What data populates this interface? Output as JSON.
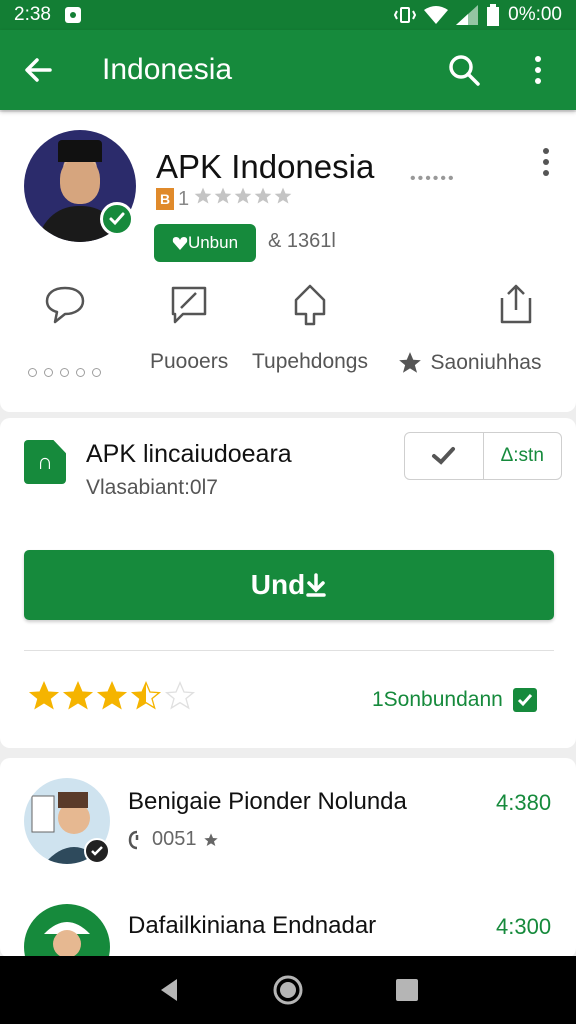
{
  "status_bar": {
    "time": "2:38",
    "battery": "0%:00"
  },
  "app_bar": {
    "title": "Indonesia"
  },
  "app_info": {
    "name": "APK Indonesia",
    "rating_badge": "B",
    "rating_text": "1",
    "rating_stars": 5,
    "install_chip": "Unbun",
    "downloads": "& 1361l",
    "actions": [
      {
        "label": ""
      },
      {
        "label": "Puooers"
      },
      {
        "label": "Tupehdongs"
      },
      {
        "label": "Saoniuhhas"
      }
    ]
  },
  "package": {
    "title": "APK lincaiudoeara",
    "version": "Vlasabiant:0l7",
    "seg_action": "Δ:stn",
    "primary_button": "Und",
    "rating_value": 3.5,
    "rating_link": "1Sonbundann"
  },
  "reviews": [
    {
      "name": "Benigaie Pionder Nolunda",
      "meta": "0051",
      "time": "4:380"
    },
    {
      "name": "Dafailkiniana Endnadar",
      "meta": "",
      "time": "4:300"
    }
  ],
  "colors": {
    "primary": "#168a3c",
    "status": "#137e34",
    "star": "#f5b400"
  }
}
